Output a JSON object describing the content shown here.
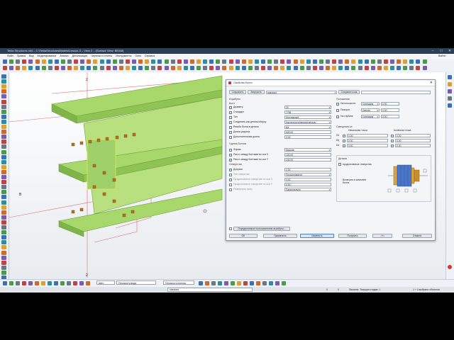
{
  "window": {
    "title": "Tekla Structures x64 – C:\\TeklaStructuresModels\\Lesson-3 – View 2 – (Surface View: BEAM)",
    "controls": [
      "–",
      "□",
      "✕"
    ]
  },
  "menubar": {
    "items": [
      "Файл",
      "Правка",
      "Вид",
      "Моделирование",
      "Анализ",
      "Детализация",
      "Чертежи и отчеты",
      "Инструменты",
      "Окно",
      "Справка"
    ],
    "user": "Войти"
  },
  "viewport": {
    "labels": [
      "2",
      "B",
      "2"
    ]
  },
  "bottombar": {
    "select1": "Авто",
    "select2": "Плоскость вида",
    "select3": "Плоскость полосы"
  },
  "statusbar": {
    "profile": "standard",
    "info": "Пиксели: Текущая стадия: 1",
    "objects": "1 + 4 выбрано объектов",
    "coord1": "0",
    "coord2": "0"
  },
  "dialog": {
    "title": "Свойства болта",
    "save_label": "Сохранить",
    "load_label": "Загрузить",
    "profile_value": "standard",
    "save_as_label": "Сохранить как",
    "left": {
      "section_attributes": "Атрибуты",
      "section_bolt": "Болт",
      "diameter_label": "Диаметр",
      "diameter_value": "20",
      "standard_label": "Стандарт",
      "standard_value": "7798",
      "type_label": "Тип",
      "type_value": "Монтажный",
      "connect_label": "Соединить как деталь/сборку",
      "connect_value": "Как второстепенная деталь",
      "thread_label": "Резьба болта в детали",
      "thread_value": "Да",
      "cut_length_label": "Длина разреза",
      "cut_length_value": "600.00",
      "extra_length_label": "Дополнительная длина",
      "extra_length_value": "0.00",
      "section_group": "Группа болтов",
      "shape_label": "Форма",
      "shape_value": "Массив",
      "dist_x_label": "Расст. между болтами по оси X",
      "dist_x_value": "100.00",
      "dist_y_label": "Расст. между болтами по оси Y",
      "dist_y_value": "100.00",
      "section_hole": "Отверстия",
      "tolerance_label": "Допуски",
      "tolerance_value": "2.00",
      "hole_type_label": "Тип отверстия",
      "hole_type_value": "Продолговатое",
      "slot_x_label": "Продолговатое отверстие по оси X",
      "slot_x_value": "0.00",
      "slot_y_label": "Продолговатое отверстие по оси Y",
      "slot_y_value": "0.00",
      "rotate_label": "Развернуть пазы",
      "rotate_value": "Параллельно",
      "udas_label": "Определяемые пользователем атрибуты..."
    },
    "right": {
      "section_position": "Положение",
      "plane_label": "На плоскости",
      "plane_value": "Середина",
      "plane_num": "0.00",
      "rotation_label": "Поворот",
      "rotation_value": "Сверху",
      "rotation_num": "0.00",
      "depth_label": "На глубине",
      "depth_value": "Середина",
      "depth_num": "0.00",
      "section_offset": "Смещения от:",
      "start_label": "Начальная точка",
      "end_label": "Конечная точка",
      "rows": [
        {
          "axis": "Dx",
          "start": "0.00",
          "end": "0.00"
        },
        {
          "axis": "Dy",
          "start": "0.00",
          "end": "0.00"
        },
        {
          "axis": "Dz",
          "start": "0.00",
          "end": "0.00"
        }
      ],
      "section_parts": "Детали",
      "slotted_label": "продолговатые отверстия",
      "include_label": "Включить в комплект болта"
    },
    "footer": {
      "ok": "OK",
      "apply": "Применить",
      "modify": "Изменить",
      "get": "Получить",
      "toggle": "✓/□",
      "cancel": "Отмена"
    }
  }
}
